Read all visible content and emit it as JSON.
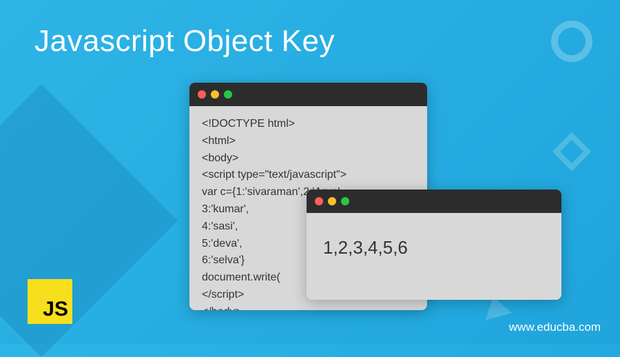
{
  "title": "Javascript Object Key",
  "code_window": {
    "lines": "<!DOCTYPE html>\n<html>\n<body>\n<script type=\"text/javascript\">\nvar c={1:'sivaraman',2:'Arun',\n3:'kumar',\n4:'sasi',\n5:'deva',\n6:'selva'}\ndocument.write(\n</script>\n</body>\n</html>"
  },
  "output_window": {
    "text": "1,2,3,4,5,6"
  },
  "logo_text": "JS",
  "brand": "www.educba.com"
}
